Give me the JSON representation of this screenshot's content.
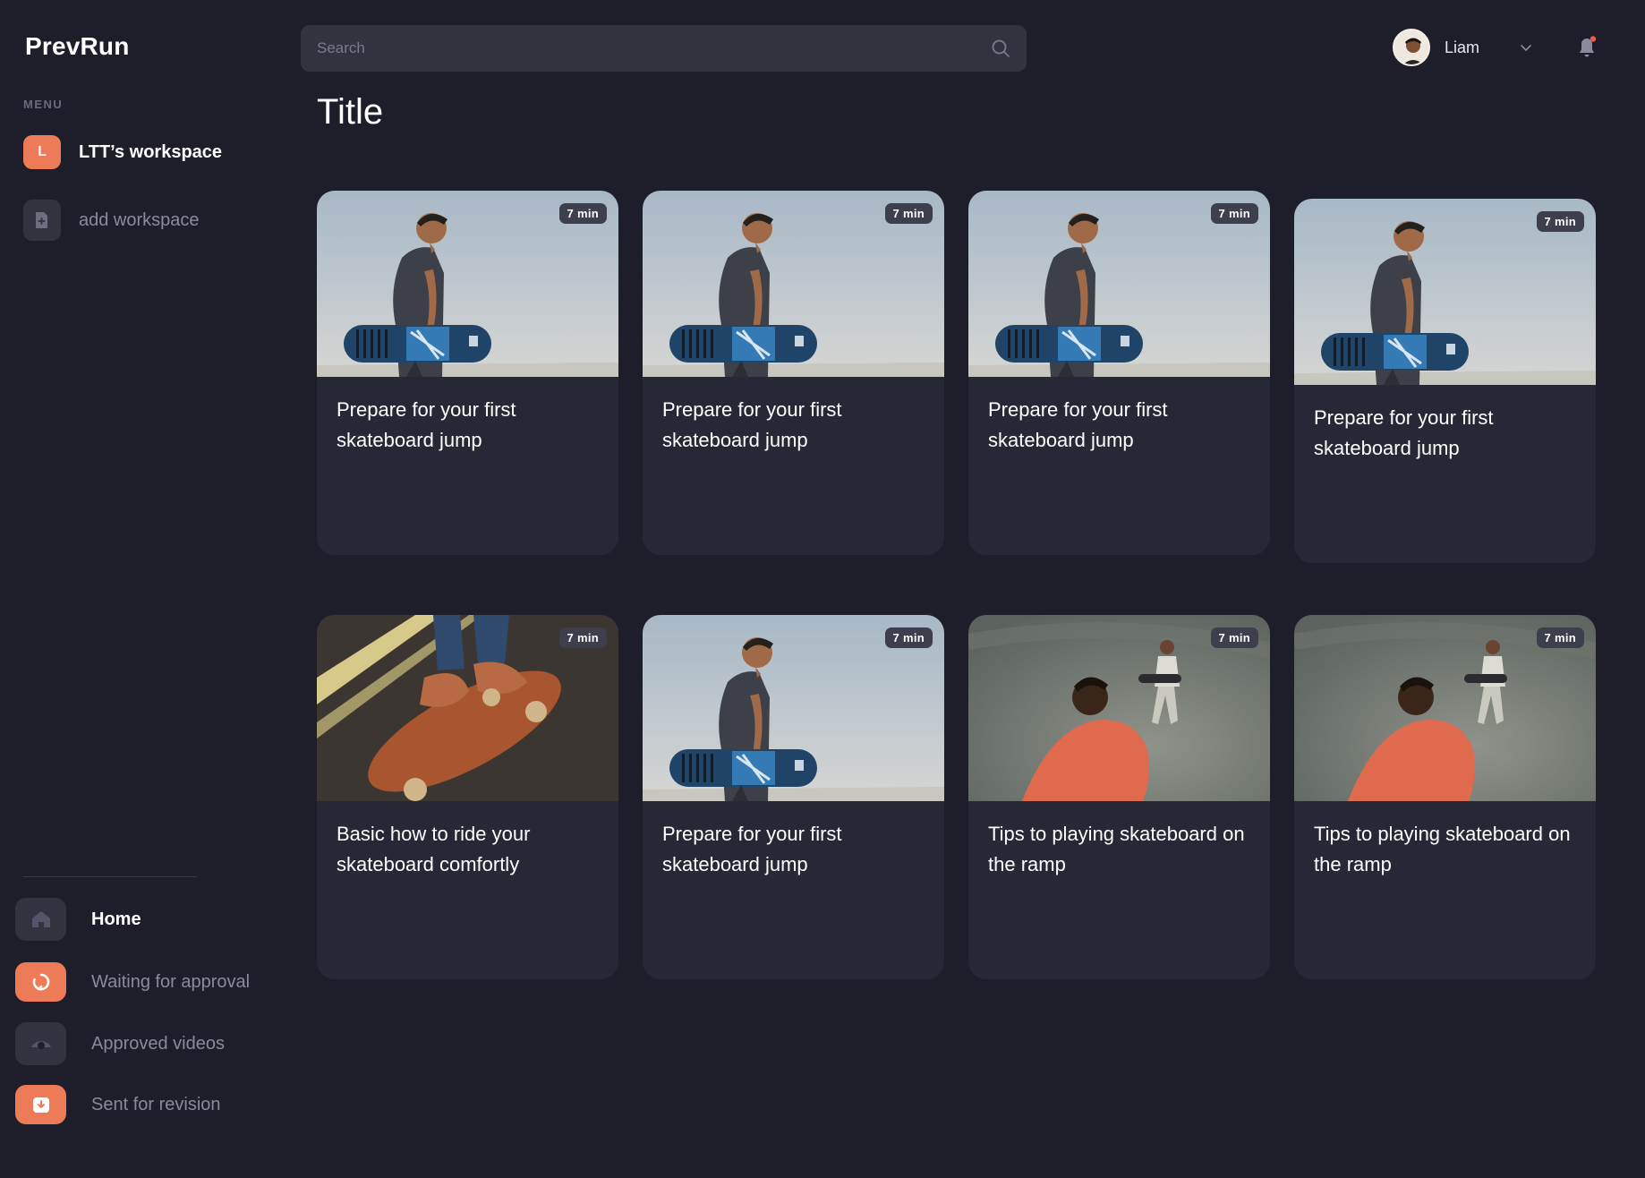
{
  "app": {
    "name": "PrevRun"
  },
  "sidebar": {
    "menu_label": "MENU",
    "workspaces": [
      {
        "initial": "L",
        "label": "LTT’s workspace",
        "active": true
      },
      {
        "label": "add workspace",
        "active": false
      }
    ],
    "nav": [
      {
        "label": "Home",
        "icon": "home-icon",
        "active": true
      },
      {
        "label": "Waiting for approval",
        "icon": "refresh-icon"
      },
      {
        "label": "Approved videos",
        "icon": "eye-icon"
      },
      {
        "label": "Sent for revision",
        "icon": "download-icon"
      }
    ]
  },
  "header": {
    "search_placeholder": "Search",
    "user_name": "Liam",
    "notification_dot": true
  },
  "main": {
    "title": "Title",
    "cards": [
      {
        "duration": "7 min",
        "title": "Prepare for your first skateboard jump",
        "image": "man-holding-skateboard"
      },
      {
        "duration": "7 min",
        "title": "Prepare for your first skateboard jump",
        "image": "man-holding-skateboard"
      },
      {
        "duration": "7 min",
        "title": "Prepare for your first skateboard jump",
        "image": "man-holding-skateboard"
      },
      {
        "duration": "7 min",
        "title": "Prepare for your first skateboard jump",
        "image": "man-holding-skateboard"
      },
      {
        "duration": "7 min",
        "title": "Basic how to ride your skateboard comfortly",
        "image": "feet-on-skateboard"
      },
      {
        "duration": "7 min",
        "title": "Prepare for your first skateboard jump",
        "image": "man-holding-skateboard"
      },
      {
        "duration": "7 min",
        "title": "Tips to playing skateboard on the ramp",
        "image": "skate-ramp"
      },
      {
        "duration": "7 min",
        "title": "Tips to playing skateboard on the ramp",
        "image": "skate-ramp"
      }
    ]
  },
  "colors": {
    "accent": "#ee7b58",
    "background": "#1e1e2a",
    "card": "#262836"
  }
}
